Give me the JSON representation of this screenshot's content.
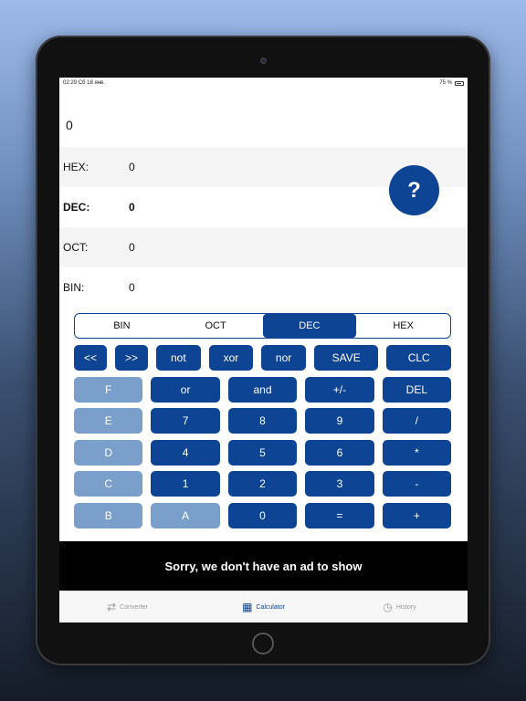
{
  "status": {
    "time": "02:29",
    "date": "Сб 18 янв.",
    "battery": "75 %"
  },
  "display": {
    "value": "0"
  },
  "help": {
    "label": "?"
  },
  "rows": [
    {
      "label": "HEX:",
      "value": "0"
    },
    {
      "label": "DEC:",
      "value": "0"
    },
    {
      "label": "OCT:",
      "value": "0"
    },
    {
      "label": "BIN:",
      "value": "0"
    }
  ],
  "modes": [
    "BIN",
    "OCT",
    "DEC",
    "HEX"
  ],
  "active_mode": "DEC",
  "keys": {
    "r1": [
      "<<",
      ">>",
      "not",
      "xor",
      "nor",
      "SAVE",
      "CLC"
    ],
    "r2": [
      "F",
      "or",
      "and",
      "+/-",
      "DEL"
    ],
    "r3": [
      "E",
      "7",
      "8",
      "9",
      "/"
    ],
    "r4": [
      "D",
      "4",
      "5",
      "6",
      "*"
    ],
    "r5": [
      "C",
      "1",
      "2",
      "3",
      "-"
    ],
    "r6": [
      "B",
      "A",
      "0",
      "=",
      "+"
    ]
  },
  "ad": {
    "text": "Sorry, we don't have an ad to show"
  },
  "tabs": [
    {
      "label": "Converter",
      "icon": "converter-icon"
    },
    {
      "label": "Calculator",
      "icon": "calculator-icon"
    },
    {
      "label": "History",
      "icon": "history-icon"
    }
  ],
  "colors": {
    "accent": "#0d4494",
    "disabled_key": "#7a9fca"
  }
}
